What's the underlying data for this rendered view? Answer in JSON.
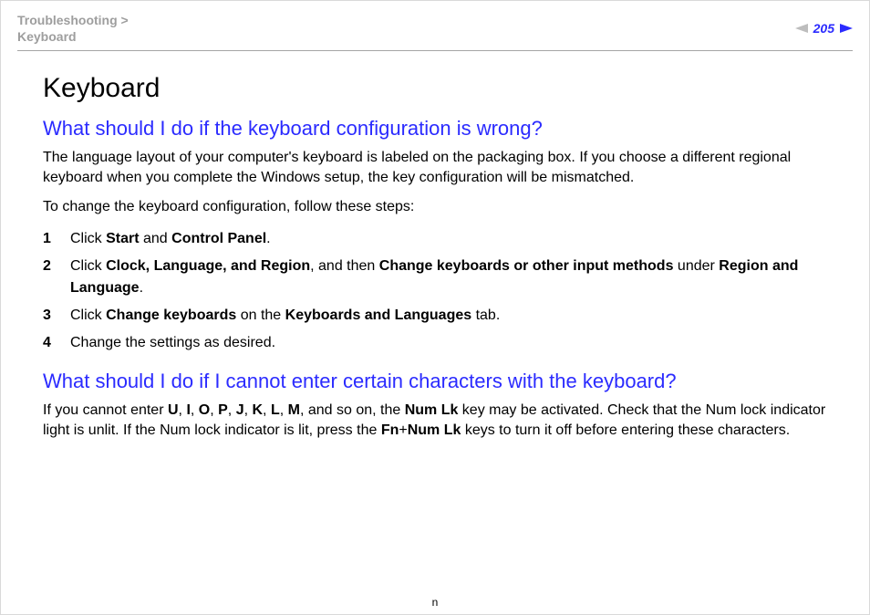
{
  "header": {
    "breadcrumb_top": "Troubleshooting >",
    "breadcrumb_sub": "Keyboard",
    "page_number": "205"
  },
  "title": "Keyboard",
  "section1": {
    "heading": "What should I do if the keyboard configuration is wrong?",
    "p1": "The language layout of your computer's keyboard is labeled on the packaging box. If you choose a different regional keyboard when you complete the Windows setup, the key configuration will be mismatched.",
    "p2": "To change the keyboard configuration, follow these steps:",
    "steps": [
      {
        "num": "1",
        "pre": "Click ",
        "b1": "Start",
        "mid1": " and ",
        "b2": "Control Panel",
        "post": "."
      },
      {
        "num": "2",
        "pre": "Click ",
        "b1": "Clock, Language, and Region",
        "mid1": ", and then ",
        "b2": "Change keyboards or other input methods",
        "mid2": " under ",
        "b3": "Region and Language",
        "post": "."
      },
      {
        "num": "3",
        "pre": "Click ",
        "b1": "Change keyboards",
        "mid1": " on the ",
        "b2": "Keyboards and Languages",
        "post": " tab."
      },
      {
        "num": "4",
        "pre": "Change the settings as desired."
      }
    ]
  },
  "section2": {
    "heading": "What should I do if I cannot enter certain characters with the keyboard?",
    "p1a": "If you cannot enter ",
    "chars": [
      "U",
      "I",
      "O",
      "P",
      "J",
      "K",
      "L",
      "M"
    ],
    "p1b": ", and so on, the ",
    "key1": "Num Lk",
    "p1c": " key may be activated. Check that the Num lock indicator light is unlit. If the Num lock indicator is lit, press the ",
    "key2": "Fn",
    "plus": "+",
    "key3": "Num Lk",
    "p1d": " keys to turn it off before entering these characters."
  },
  "footer": {
    "n": "n"
  }
}
